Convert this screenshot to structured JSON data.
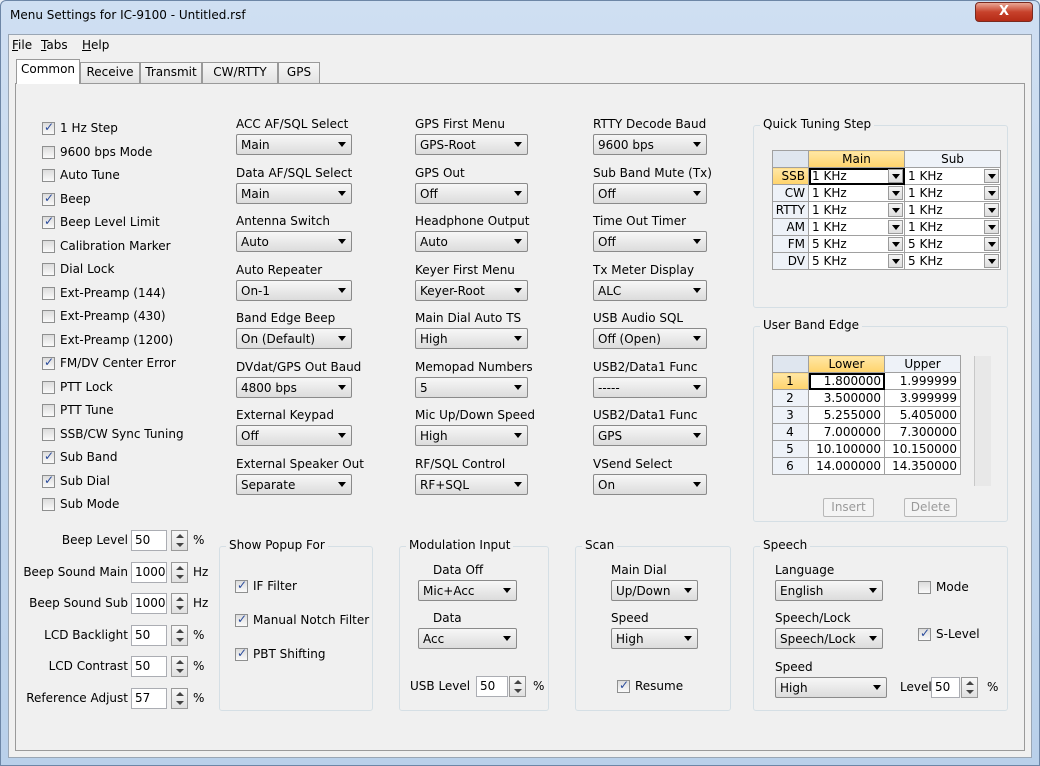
{
  "window": {
    "title": "Menu Settings for IC-9100 - Untitled.rsf",
    "close_glyph": "X"
  },
  "menubar": [
    {
      "key": "F",
      "rest": "ile"
    },
    {
      "key": "T",
      "rest": "abs"
    },
    {
      "key": "H",
      "rest": "elp"
    }
  ],
  "tabs": [
    "Common",
    "Receive",
    "Transmit",
    "CW/RTTY",
    "GPS"
  ],
  "active_tab": "Common",
  "checkboxes": [
    {
      "label": "1 Hz Step",
      "checked": true
    },
    {
      "label": "9600 bps Mode",
      "checked": false
    },
    {
      "label": "Auto Tune",
      "checked": false
    },
    {
      "label": "Beep",
      "checked": true
    },
    {
      "label": "Beep Level Limit",
      "checked": true
    },
    {
      "label": "Calibration Marker",
      "checked": false
    },
    {
      "label": "Dial Lock",
      "checked": false
    },
    {
      "label": "Ext-Preamp (144)",
      "checked": false
    },
    {
      "label": "Ext-Preamp (430)",
      "checked": false
    },
    {
      "label": "Ext-Preamp (1200)",
      "checked": false
    },
    {
      "label": "FM/DV Center Error",
      "checked": true
    },
    {
      "label": "PTT Lock",
      "checked": false
    },
    {
      "label": "PTT Tune",
      "checked": false
    },
    {
      "label": "SSB/CW Sync Tuning",
      "checked": false
    },
    {
      "label": "Sub Band",
      "checked": true
    },
    {
      "label": "Sub Dial",
      "checked": true
    },
    {
      "label": "Sub Mode",
      "checked": false
    }
  ],
  "dropdown_columns": [
    [
      {
        "label": "ACC AF/SQL Select",
        "value": "Main"
      },
      {
        "label": "Data AF/SQL Select",
        "value": "Main"
      },
      {
        "label": "Antenna Switch",
        "value": "Auto"
      },
      {
        "label": "Auto Repeater",
        "value": "On-1"
      },
      {
        "label": "Band Edge Beep",
        "value": "On (Default)"
      },
      {
        "label": "DVdat/GPS Out Baud",
        "value": "4800 bps"
      },
      {
        "label": "External Keypad",
        "value": "Off"
      },
      {
        "label": "External Speaker Out",
        "value": "Separate"
      }
    ],
    [
      {
        "label": "GPS First Menu",
        "value": "GPS-Root"
      },
      {
        "label": "GPS Out",
        "value": "Off"
      },
      {
        "label": "Headphone Output",
        "value": "Auto"
      },
      {
        "label": "Keyer First Menu",
        "value": "Keyer-Root"
      },
      {
        "label": "Main Dial Auto TS",
        "value": "High"
      },
      {
        "label": "Memopad Numbers",
        "value": "5"
      },
      {
        "label": "Mic Up/Down Speed",
        "value": "High"
      },
      {
        "label": "RF/SQL Control",
        "value": "RF+SQL"
      }
    ],
    [
      {
        "label": "RTTY Decode Baud",
        "value": "9600 bps"
      },
      {
        "label": "Sub Band Mute (Tx)",
        "value": "Off"
      },
      {
        "label": "Time Out Timer",
        "value": "Off"
      },
      {
        "label": "Tx Meter Display",
        "value": "ALC"
      },
      {
        "label": "USB Audio SQL",
        "value": "Off (Open)"
      },
      {
        "label": "USB2/Data1 Func",
        "value": "-----"
      },
      {
        "label": "USB2/Data1 Func",
        "value": "GPS"
      },
      {
        "label": "VSend Select",
        "value": "On"
      }
    ]
  ],
  "quick_tuning": {
    "title": "Quick Tuning Step",
    "headers": [
      "Main",
      "Sub"
    ],
    "rows": [
      {
        "mode": "SSB",
        "main": "1 KHz",
        "sub": "1 KHz"
      },
      {
        "mode": "CW",
        "main": "1 KHz",
        "sub": "1 KHz"
      },
      {
        "mode": "RTTY",
        "main": "1 KHz",
        "sub": "1 KHz"
      },
      {
        "mode": "AM",
        "main": "1 KHz",
        "sub": "1 KHz"
      },
      {
        "mode": "FM",
        "main": "5 KHz",
        "sub": "5 KHz"
      },
      {
        "mode": "DV",
        "main": "5 KHz",
        "sub": "5 KHz"
      }
    ]
  },
  "band_edge": {
    "title": "User Band Edge",
    "headers": [
      "Lower",
      "Upper"
    ],
    "rows": [
      {
        "n": "1",
        "lower": "1.800000",
        "upper": "1.999999"
      },
      {
        "n": "2",
        "lower": "3.500000",
        "upper": "3.999999"
      },
      {
        "n": "3",
        "lower": "5.255000",
        "upper": "5.405000"
      },
      {
        "n": "4",
        "lower": "7.000000",
        "upper": "7.300000"
      },
      {
        "n": "5",
        "lower": "10.100000",
        "upper": "10.150000"
      },
      {
        "n": "6",
        "lower": "14.000000",
        "upper": "14.350000"
      }
    ],
    "insert_label": "Insert",
    "delete_label": "Delete"
  },
  "levels": [
    {
      "label": "Beep Level",
      "value": "50",
      "unit": "%"
    },
    {
      "label": "Beep Sound Main",
      "value": "1000",
      "unit": "Hz"
    },
    {
      "label": "Beep Sound Sub",
      "value": "1000",
      "unit": "Hz"
    },
    {
      "label": "LCD Backlight",
      "value": "50",
      "unit": "%"
    },
    {
      "label": "LCD Contrast",
      "value": "50",
      "unit": "%"
    },
    {
      "label": "Reference Adjust",
      "value": "57",
      "unit": "%"
    }
  ],
  "popup": {
    "title": "Show Popup For",
    "items": [
      {
        "label": "IF Filter",
        "checked": true
      },
      {
        "label": "Manual Notch Filter",
        "checked": true
      },
      {
        "label": "PBT Shifting",
        "checked": true
      }
    ]
  },
  "modulation": {
    "title": "Modulation Input",
    "data_off_label": "Data Off",
    "data_off_value": "Mic+Acc",
    "data_label": "Data",
    "data_value": "Acc",
    "usb_level_label": "USB Level",
    "usb_level_value": "50",
    "usb_level_unit": "%"
  },
  "scan": {
    "title": "Scan",
    "main_dial_label": "Main Dial",
    "main_dial_value": "Up/Down",
    "speed_label": "Speed",
    "speed_value": "High",
    "resume_label": "Resume",
    "resume_checked": true
  },
  "speech": {
    "title": "Speech",
    "language_label": "Language",
    "language_value": "English",
    "mode_label": "Mode",
    "mode_checked": false,
    "lock_label": "Speech/Lock",
    "lock_value": "Speech/Lock",
    "slevel_label": "S-Level",
    "slevel_checked": true,
    "speed_label": "Speed",
    "speed_value": "High",
    "level_label": "Level",
    "level_value": "50",
    "level_unit": "%"
  }
}
